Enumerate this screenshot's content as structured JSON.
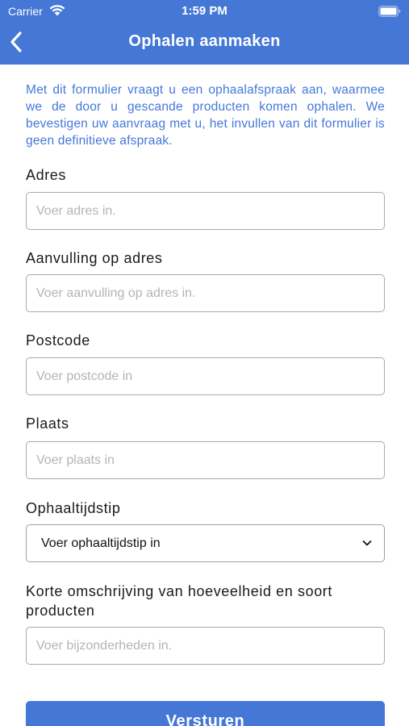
{
  "status_bar": {
    "carrier": "Carrier",
    "time": "1:59 PM"
  },
  "nav": {
    "title": "Ophalen aanmaken",
    "back_icon": "chevron-left-icon"
  },
  "intro_text": "Met dit formulier vraagt u een ophaalafspraak aan, waarmee we de door u gescande producten komen ophalen. We bevestigen uw aanvraag met u, het invullen van dit formulier is geen definitieve afspraak.",
  "form": {
    "address": {
      "label": "Adres",
      "placeholder": "Voer adres in.",
      "value": ""
    },
    "address_extra": {
      "label": "Aanvulling op adres",
      "placeholder": "Voer aanvulling op adres in.",
      "value": ""
    },
    "postcode": {
      "label": "Postcode",
      "placeholder": "Voer postcode in",
      "value": ""
    },
    "city": {
      "label": "Plaats",
      "placeholder": "Voer plaats in",
      "value": ""
    },
    "pickup_time": {
      "label": "Ophaaltijdstip",
      "selected": "Voer ophaaltijdstip in"
    },
    "description": {
      "label": "Korte omschrijving van hoeveelheid en soort producten",
      "placeholder": "Voer bijzonderheden in.",
      "value": ""
    }
  },
  "submit_label": "Versturen",
  "colors": {
    "brand": "#4477d6",
    "intro_text": "#4478d8",
    "border": "#a9a9a9"
  }
}
